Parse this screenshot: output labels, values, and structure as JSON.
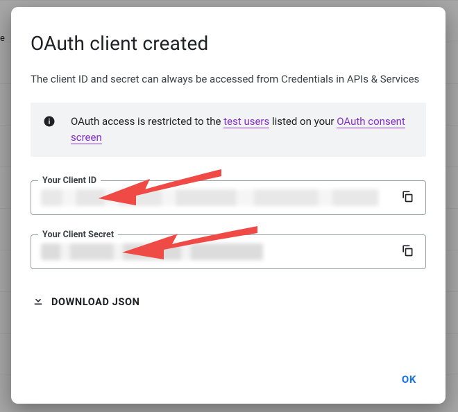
{
  "dialog": {
    "title": "OAuth client created",
    "subtitle": "The client ID and secret can always be accessed from Credentials in APIs & Services",
    "notice": {
      "prefix": "OAuth access is restricted to the ",
      "link1": "test users",
      "mid": " listed on your ",
      "link2": "OAuth consent screen"
    },
    "client_id": {
      "label": "Your Client ID",
      "value": ""
    },
    "client_secret": {
      "label": "Your Client Secret",
      "value": ""
    },
    "download_label": "Download JSON",
    "ok_label": "OK"
  },
  "background": {
    "left_edge_char": "e"
  }
}
